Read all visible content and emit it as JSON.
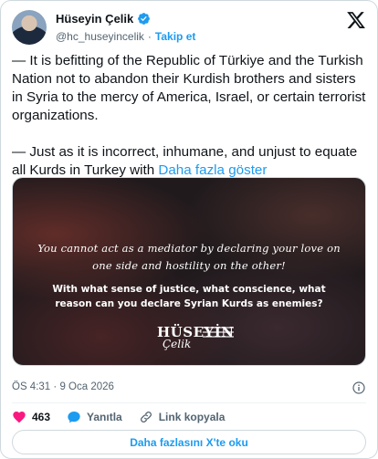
{
  "author": {
    "name": "Hüseyin Çelik",
    "handle": "@hc_huseyincelik",
    "separator": "·",
    "follow_label": "Takip et"
  },
  "tweet": {
    "paragraph_1": "— It is befitting of the Republic of Türkiye and the Turkish Nation not to abandon their Kurdish brothers and sisters in Syria to the mercy of America, Israel, or certain terrorist organizations.",
    "paragraph_2": "— Just as it is incorrect, inhumane, and unjust to equate all Kurds in Turkey with",
    "show_more": "Daha fazla göster"
  },
  "media": {
    "quote": "You cannot act as a mediator by declaring your love on one side and hostility on the other!",
    "subtext": "With what sense of justice, what conscience, what reason can you declare Syrian Kurds as enemies?",
    "signature_name": "HÜSEYİN",
    "signature_script": "Çelik"
  },
  "meta": {
    "time": "ÖS 4:31",
    "separator": "·",
    "date": "9 Oca 2026"
  },
  "actions": {
    "likes": "463",
    "reply_label": "Yanıtla",
    "copy_link_label": "Link kopyala"
  },
  "read_more_button": "Daha fazlasını X'te oku",
  "colors": {
    "accent": "#1d9bf0",
    "like": "#f91880",
    "text": "#0f1419",
    "muted": "#536471"
  },
  "icons": [
    "verified-badge-icon",
    "x-logo-icon",
    "info-icon",
    "heart-icon",
    "reply-icon",
    "link-icon"
  ]
}
